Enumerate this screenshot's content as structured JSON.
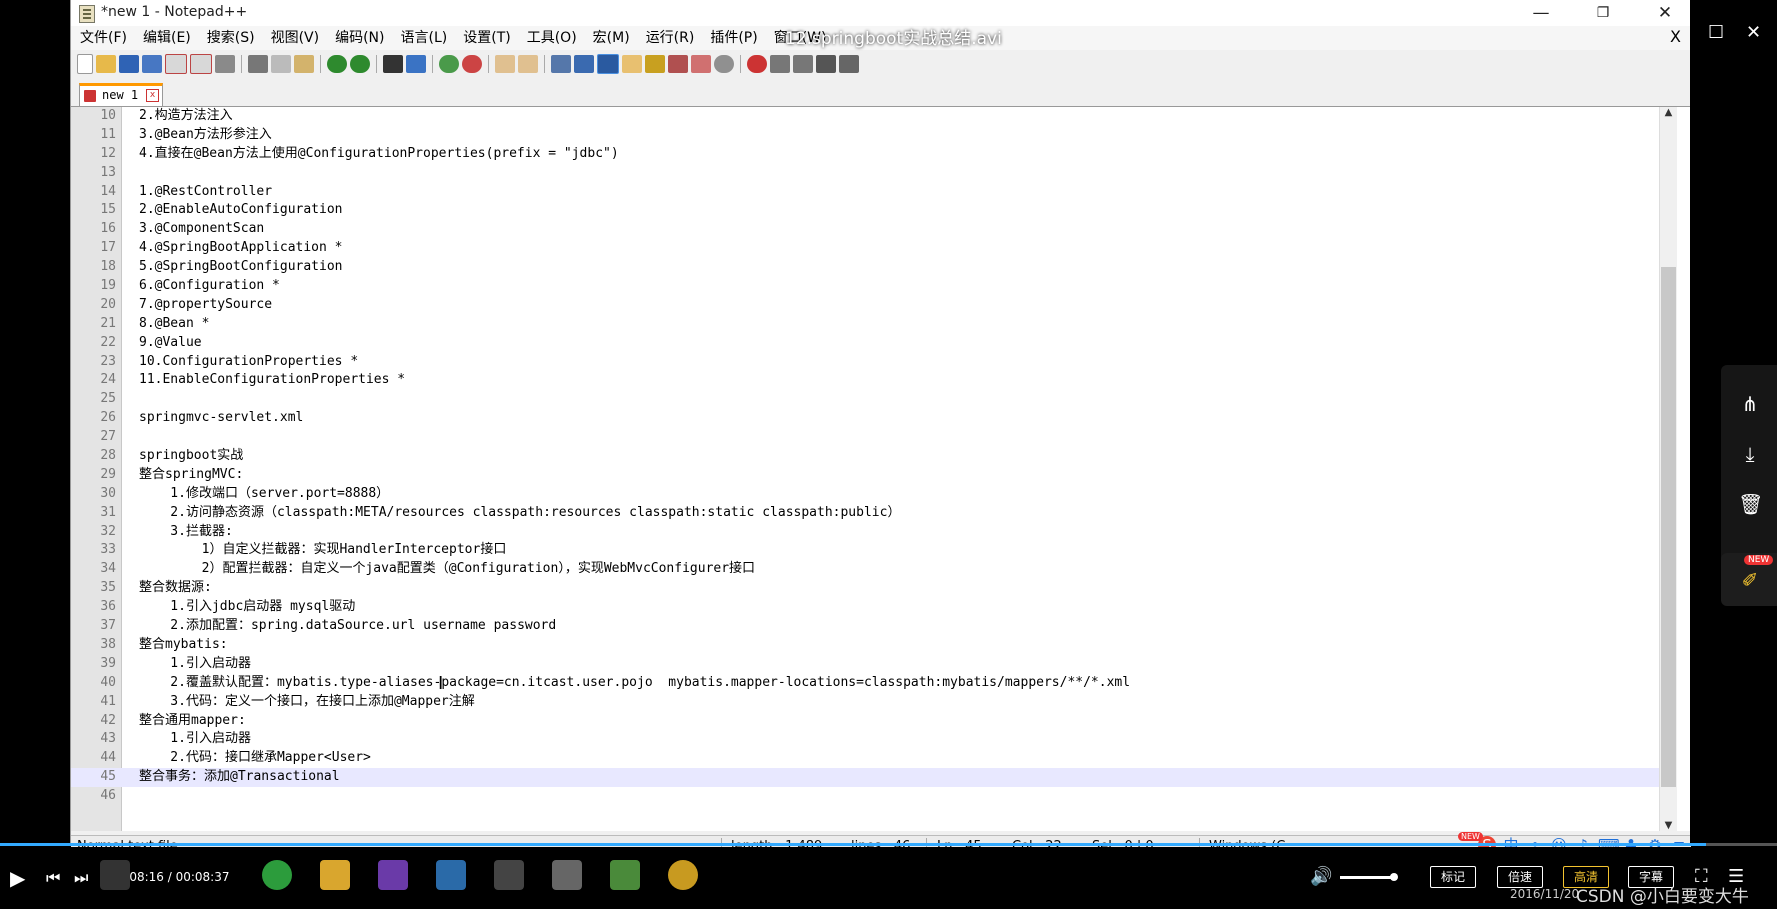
{
  "window": {
    "title": "*new 1 - Notepad++",
    "min": "—",
    "max": "❐",
    "close": "✕"
  },
  "video_title": "12.springboot实战总结.avi",
  "menu": [
    "文件(F)",
    "编辑(E)",
    "搜索(S)",
    "视图(V)",
    "编码(N)",
    "语言(L)",
    "设置(T)",
    "工具(O)",
    "宏(M)",
    "运行(R)",
    "插件(P)",
    "窗口(W)"
  ],
  "menu_close": "X",
  "tab": {
    "label": "new 1",
    "close": "x"
  },
  "lines": [
    {
      "n": "10",
      "t": "2.构造方法注入"
    },
    {
      "n": "11",
      "t": "3.@Bean方法形参注入"
    },
    {
      "n": "12",
      "t": "4.直接在@Bean方法上使用@ConfigurationProperties(prefix = \"jdbc\")"
    },
    {
      "n": "13",
      "t": ""
    },
    {
      "n": "14",
      "t": "1.@RestController"
    },
    {
      "n": "15",
      "t": "2.@EnableAutoConfiguration"
    },
    {
      "n": "16",
      "t": "3.@ComponentScan"
    },
    {
      "n": "17",
      "t": "4.@SpringBootApplication *"
    },
    {
      "n": "18",
      "t": "5.@SpringBootConfiguration"
    },
    {
      "n": "19",
      "t": "6.@Configuration *"
    },
    {
      "n": "20",
      "t": "7.@propertySource"
    },
    {
      "n": "21",
      "t": "8.@Bean *"
    },
    {
      "n": "22",
      "t": "9.@Value"
    },
    {
      "n": "23",
      "t": "10.ConfigurationProperties *"
    },
    {
      "n": "24",
      "t": "11.EnableConfigurationProperties *"
    },
    {
      "n": "25",
      "t": ""
    },
    {
      "n": "26",
      "t": "springmvc-servlet.xml"
    },
    {
      "n": "27",
      "t": ""
    },
    {
      "n": "28",
      "t": "springboot实战"
    },
    {
      "n": "29",
      "t": "整合springMVC:"
    },
    {
      "n": "30",
      "t": "    1.修改端口（server.port=8888）"
    },
    {
      "n": "31",
      "t": "    2.访问静态资源（classpath:META/resources classpath:resources classpath:static classpath:public）"
    },
    {
      "n": "32",
      "t": "    3.拦截器:"
    },
    {
      "n": "33",
      "t": "        1）自定义拦截器：实现HandlerInterceptor接口"
    },
    {
      "n": "34",
      "t": "        2）配置拦截器：自定义一个java配置类（@Configuration），实现WebMvcConfigurer接口"
    },
    {
      "n": "35",
      "t": "整合数据源:"
    },
    {
      "n": "36",
      "t": "    1.引入jdbc启动器 mysql驱动"
    },
    {
      "n": "37",
      "t": "    2.添加配置：spring.dataSource.url username password"
    },
    {
      "n": "38",
      "t": "整合mybatis:"
    },
    {
      "n": "39",
      "t": "    1.引入启动器"
    },
    {
      "n": "40",
      "t": "    2.覆盖默认配置：mybatis.type-aliases-package=cn.itcast.user.pojo  mybatis.mapper-locations=classpath:mybatis/mappers/**/*.xml"
    },
    {
      "n": "41",
      "t": "    3.代码：定义一个接口，在接口上添加@Mapper注解"
    },
    {
      "n": "42",
      "t": "整合通用mapper:"
    },
    {
      "n": "43",
      "t": "    1.引入启动器"
    },
    {
      "n": "44",
      "t": "    2.代码：接口继承Mapper<User>"
    },
    {
      "n": "45",
      "t": "整合事务：添加@Transactional"
    },
    {
      "n": "46",
      "t": ""
    }
  ],
  "current_line": "45",
  "status": {
    "filetype": "Normal text file",
    "length": "length : 1,489",
    "lines": "lines : 46",
    "ln": "Ln : 45",
    "col": "Col : 22",
    "sel": "Sel : 0 | 0",
    "eol": "Windows (C"
  },
  "player": {
    "time": "00:08:16 / 00:08:37",
    "progress": 0.96,
    "btn_bookmark": "标记",
    "btn_speed": "倍速",
    "btn_quality": "高清",
    "btn_subtitle": "字幕",
    "clock": "2016/11/20",
    "watermark": "CSDN @小白要变大牛",
    "ime_badge": "NEW",
    "pin_badge": "NEW",
    "ime_char": "中"
  }
}
